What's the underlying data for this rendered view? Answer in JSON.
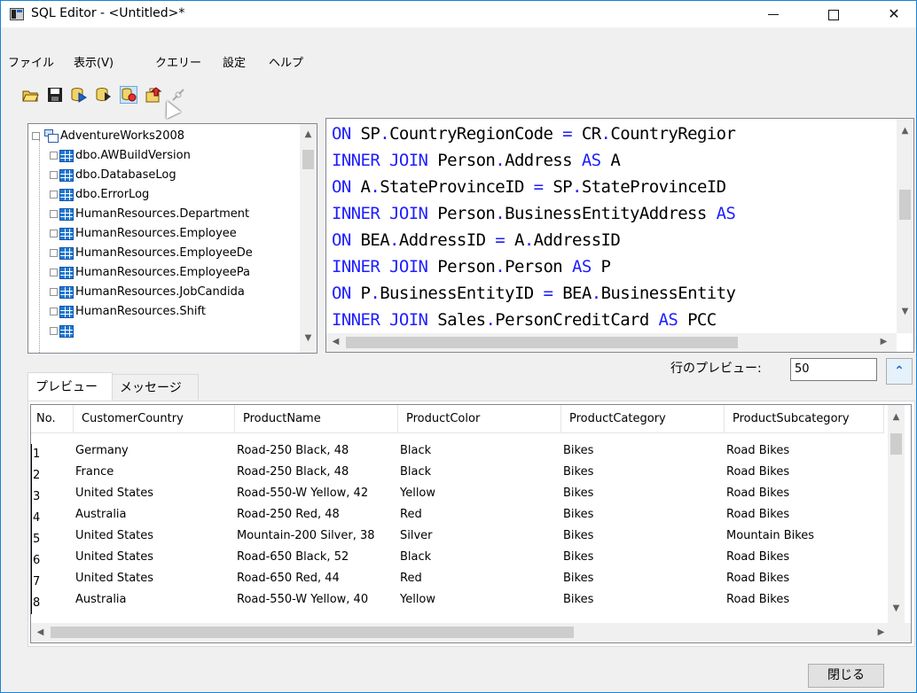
{
  "window": {
    "title": "SQL Editor - <Untitled>*",
    "minimize": "—",
    "maximize": "☐",
    "close": "✕"
  },
  "menu": {
    "items": [
      "ファイル",
      "表示(V)",
      "クエリー",
      "設定",
      "ヘルプ"
    ]
  },
  "toolbar": {
    "icons": [
      "open-folder-icon",
      "save-icon",
      "run-icon",
      "run-selection-icon",
      "import-icon",
      "export-icon",
      "disconnect-icon"
    ]
  },
  "tree": {
    "root": "AdventureWorks2008",
    "items": [
      "dbo.AWBuildVersion",
      "dbo.DatabaseLog",
      "dbo.ErrorLog",
      "HumanResources.Department",
      "HumanResources.Employee",
      "HumanResources.EmployeeDe",
      "HumanResources.EmployeePa",
      "HumanResources.JobCandida",
      "HumanResources.Shift"
    ]
  },
  "editor": {
    "lines": [
      [
        "ON",
        " SP",
        ".",
        "CountryRegionCode",
        " = ",
        "CR",
        ".",
        "CountryRegior"
      ],
      [
        "INNER JOIN",
        " Person",
        ".",
        "Address",
        " AS",
        " A"
      ],
      [
        "ON",
        " A",
        ".",
        "StateProvinceID",
        " = ",
        "SP",
        ".",
        "StateProvinceID"
      ],
      [
        "INNER JOIN",
        " Person",
        ".",
        "BusinessEntityAddress",
        " AS"
      ],
      [
        "ON",
        " BEA",
        ".",
        "AddressID",
        " = ",
        "A",
        ".",
        "AddressID"
      ],
      [
        "INNER JOIN",
        " Person",
        ".",
        "Person",
        " AS",
        " P"
      ],
      [
        "ON",
        " P",
        ".",
        "BusinessEntityID",
        " = ",
        "BEA",
        ".",
        "BusinessEntity"
      ],
      [
        "INNER JOIN",
        " Sales",
        ".",
        "PersonCreditCard",
        " AS",
        " PCC"
      ]
    ]
  },
  "preview": {
    "label": "行のプレビュー:",
    "value": "50",
    "collapse": "≈"
  },
  "tabs": {
    "preview": "プレビュー",
    "messages": "メッセージ"
  },
  "grid": {
    "columns": [
      "No.",
      "CustomerCountry",
      "ProductName",
      "ProductColor",
      "ProductCategory",
      "ProductSubcategory"
    ],
    "rows": [
      [
        "1",
        "Germany",
        "Road-250 Black, 48",
        "Black",
        "Bikes",
        "Road Bikes"
      ],
      [
        "2",
        "France",
        "Road-250 Black, 48",
        "Black",
        "Bikes",
        "Road Bikes"
      ],
      [
        "3",
        "United States",
        "Road-550-W Yellow, 42",
        "Yellow",
        "Bikes",
        "Road Bikes"
      ],
      [
        "4",
        "Australia",
        "Road-250 Red, 48",
        "Red",
        "Bikes",
        "Road Bikes"
      ],
      [
        "5",
        "United States",
        "Mountain-200 Silver, 38",
        "Silver",
        "Bikes",
        "Mountain Bikes"
      ],
      [
        "6",
        "United States",
        "Road-650 Black, 52",
        "Black",
        "Bikes",
        "Road Bikes"
      ],
      [
        "7",
        "United States",
        "Road-650 Red, 44",
        "Red",
        "Bikes",
        "Road Bikes"
      ],
      [
        "8",
        "Australia",
        "Road-550-W Yellow, 40",
        "Yellow",
        "Bikes",
        "Road Bikes"
      ]
    ]
  },
  "footer": {
    "close": "閉じる"
  },
  "colors": {
    "keyword": "#1e1eff",
    "accent": "#1e64c8",
    "border": "#1883d7"
  }
}
